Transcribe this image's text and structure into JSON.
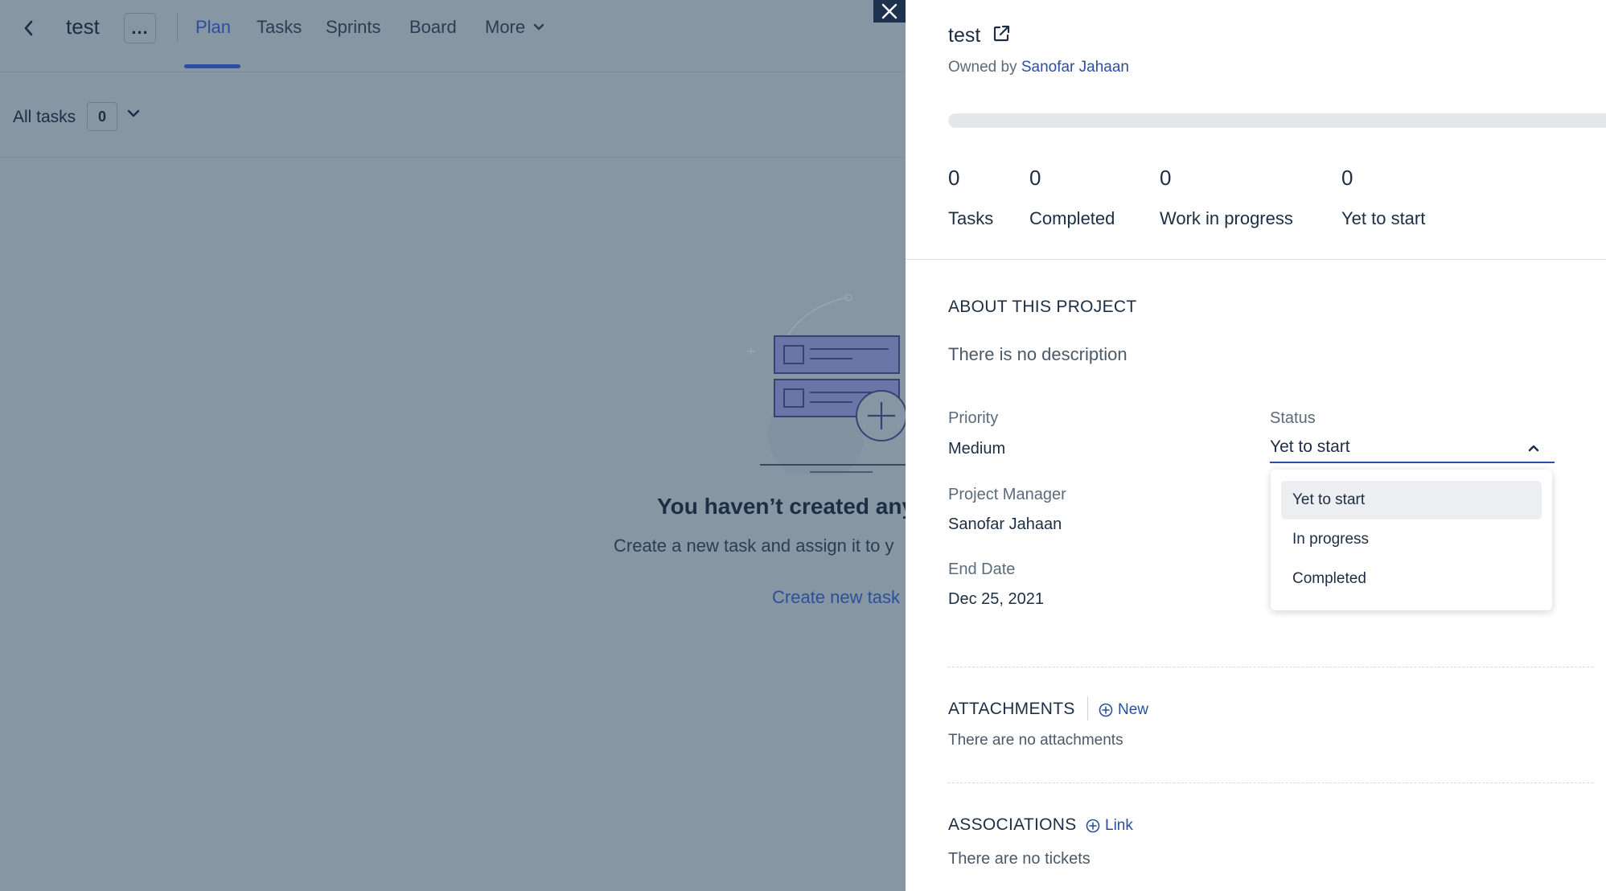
{
  "background": {
    "project_title": "test",
    "more_dots": "...",
    "tabs": [
      {
        "label": "Plan"
      },
      {
        "label": "Tasks"
      },
      {
        "label": "Sprints"
      },
      {
        "label": "Board"
      },
      {
        "label": "More"
      }
    ],
    "filter": {
      "label": "All tasks",
      "count": "0"
    },
    "empty_state": {
      "title": "You haven’t created any",
      "subtitle": "Create a new task and assign it to y",
      "link": "Create new task"
    }
  },
  "panel": {
    "title": "test",
    "owned_prefix": "Owned by",
    "owner": "Sanofar Jahaan",
    "progress_fraction": 0,
    "stats": [
      {
        "value": "0",
        "label": "Tasks"
      },
      {
        "value": "0",
        "label": "Completed"
      },
      {
        "value": "0",
        "label": "Work in progress"
      },
      {
        "value": "0",
        "label": "Yet to start"
      }
    ],
    "about": {
      "heading": "ABOUT THIS PROJECT",
      "description": "There is no description"
    },
    "fields": {
      "priority_label": "Priority",
      "priority_value": "Medium",
      "manager_label": "Project Manager",
      "manager_value": "Sanofar Jahaan",
      "end_date_label": "End Date",
      "end_date_value": "Dec 25, 2021",
      "status_label": "Status",
      "status_value": "Yet to start"
    },
    "status_options": [
      "Yet to start",
      "In progress",
      "Completed"
    ],
    "attachments": {
      "heading": "ATTACHMENTS",
      "action": "New",
      "empty": "There are no attachments"
    },
    "associations": {
      "heading": "ASSOCIATIONS",
      "action": "Link",
      "empty": "There are no tickets"
    }
  },
  "colors": {
    "accent": "#2a4f9e",
    "text_dark": "#1d2e44",
    "overlay_bg": "#8796a3",
    "close_button_bg": "#1e3250"
  },
  "icons": [
    "back-arrow-icon",
    "chevron-down-icon",
    "close-icon",
    "external-link-icon",
    "chevron-up-icon",
    "plus-circle-icon"
  ]
}
